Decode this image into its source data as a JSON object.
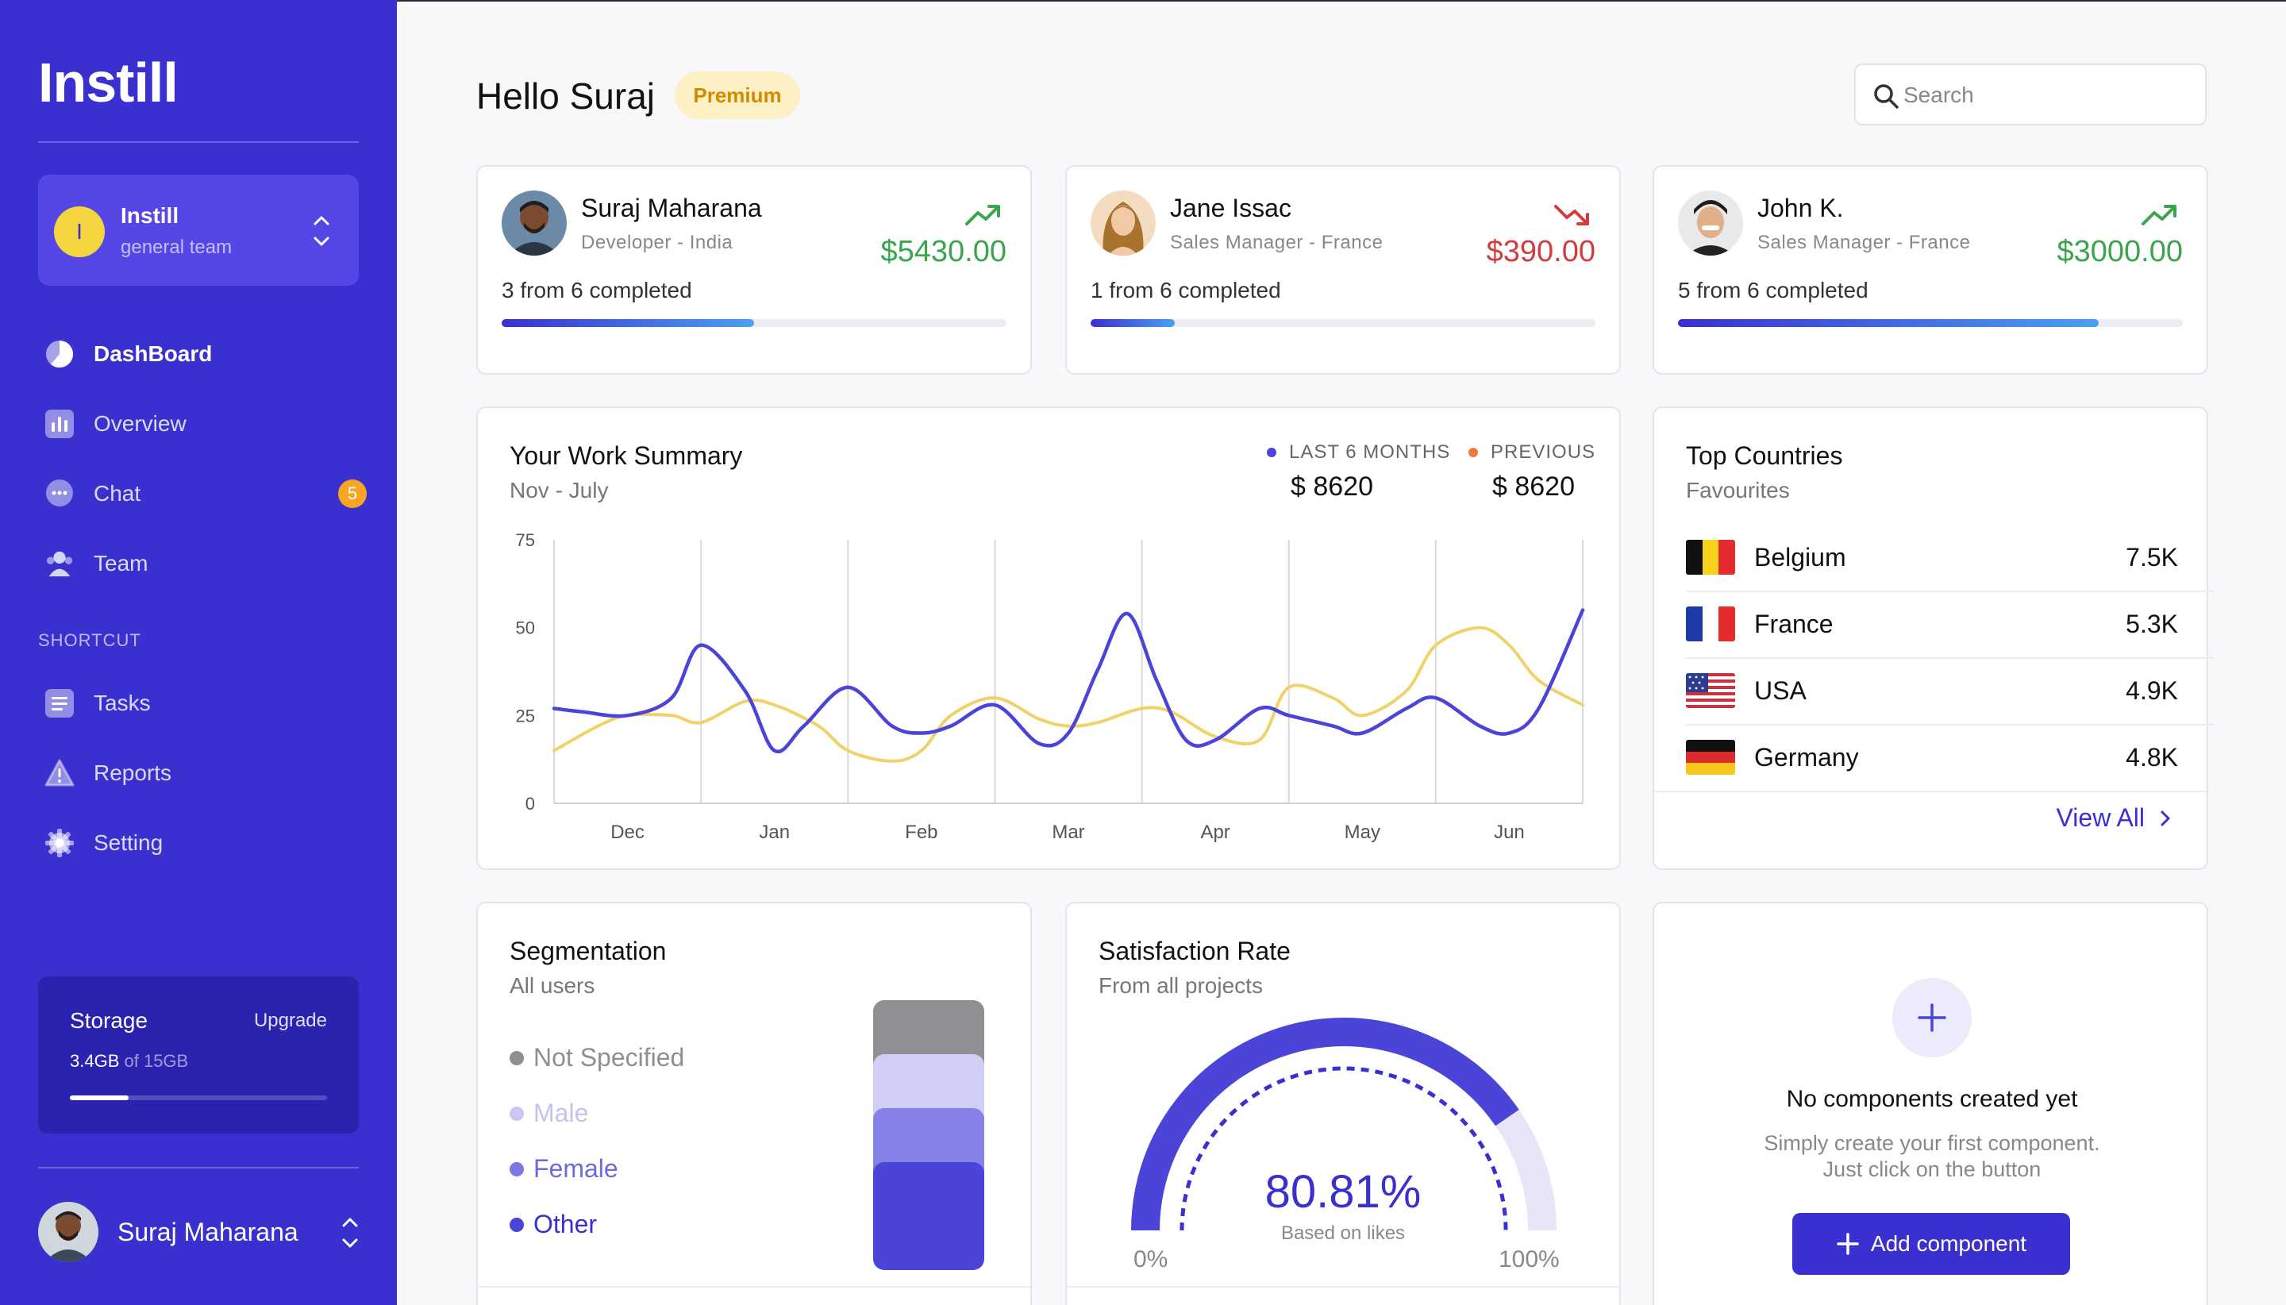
{
  "app": {
    "brand": "Instill"
  },
  "team": {
    "initial": "I",
    "name": "Instill",
    "subtitle": "general team"
  },
  "nav": [
    {
      "label": "DashBoard",
      "icon": "pie-chart-icon",
      "active": true
    },
    {
      "label": "Overview",
      "icon": "bar-chart-icon"
    },
    {
      "label": "Chat",
      "icon": "chat-icon",
      "badge": "5"
    },
    {
      "label": "Team",
      "icon": "team-icon"
    }
  ],
  "shortcut": {
    "label": "SHORTCUT",
    "items": [
      {
        "label": "Tasks",
        "icon": "tasks-icon"
      },
      {
        "label": "Reports",
        "icon": "reports-icon"
      },
      {
        "label": "Setting",
        "icon": "gear-icon"
      }
    ]
  },
  "storage": {
    "title": "Storage",
    "upgrade": "Upgrade",
    "used": "3.4GB",
    "of_text": "of 15GB",
    "fraction": 0.227
  },
  "user": {
    "name": "Suraj Maharana"
  },
  "header": {
    "greeting": "Hello Suraj",
    "badge": "Premium",
    "search_placeholder": "Search"
  },
  "people": [
    {
      "name": "Suraj Maharana",
      "role": "Developer - India",
      "amount": "$5430.00",
      "trend": "up",
      "progress": "3 from 6 completed",
      "fraction": 0.5
    },
    {
      "name": "Jane Issac",
      "role": "Sales Manager - France",
      "amount": "$390.00",
      "trend": "down",
      "progress": "1 from 6 completed",
      "fraction": 0.167
    },
    {
      "name": "John K.",
      "role": "Sales Manager - France",
      "amount": "$3000.00",
      "trend": "up",
      "progress": "5 from 6 completed",
      "fraction": 0.833
    }
  ],
  "work_summary": {
    "title": "Your Work Summary",
    "subtitle": "Nov - July",
    "legend": [
      {
        "label": "LAST 6 MONTHS",
        "value": "$ 8620",
        "color": "#4a44d8"
      },
      {
        "label": "PREVIOUS",
        "value": "$ 8620",
        "color": "#f07a3a"
      }
    ]
  },
  "chart_data": {
    "type": "line",
    "x_ticks": [
      "Dec",
      "Jan",
      "Feb",
      "Mar",
      "Apr",
      "May",
      "Jun"
    ],
    "y_ticks": [
      0,
      25,
      50,
      75
    ],
    "ylim": [
      0,
      75
    ],
    "xlim": [
      -0.5,
      6.5
    ],
    "grid": "vertical",
    "series": [
      {
        "color": "#4a44d8",
        "x": [
          -0.5,
          -0.3,
          0,
          0.3,
          0.5,
          0.8,
          1.0,
          1.2,
          1.5,
          1.8,
          2.0,
          2.2,
          2.5,
          2.8,
          3.0,
          3.2,
          3.4,
          3.6,
          3.8,
          4.0,
          4.3,
          4.5,
          4.8,
          5.0,
          5.3,
          5.5,
          5.8,
          6.0,
          6.2,
          6.5
        ],
        "y": [
          27,
          26,
          25,
          30,
          45,
          32,
          15,
          22,
          33,
          22,
          20,
          22,
          28,
          17,
          20,
          38,
          54,
          35,
          18,
          18,
          27,
          25,
          22,
          20,
          27,
          30,
          22,
          20,
          27,
          55
        ]
      },
      {
        "color": "#f0d26a",
        "x": [
          -0.5,
          -0.2,
          0,
          0.3,
          0.5,
          0.8,
          1.0,
          1.3,
          1.5,
          1.8,
          2.0,
          2.2,
          2.5,
          2.8,
          3.0,
          3.2,
          3.5,
          3.7,
          4.0,
          4.3,
          4.5,
          4.8,
          5.0,
          5.3,
          5.5,
          5.8,
          6.0,
          6.2,
          6.5
        ],
        "y": [
          15,
          22,
          25,
          25,
          23,
          29,
          28,
          22,
          15,
          12,
          15,
          25,
          30,
          24,
          22,
          23,
          27,
          26,
          19,
          18,
          33,
          30,
          25,
          32,
          45,
          50,
          45,
          35,
          28
        ]
      }
    ]
  },
  "countries": {
    "title": "Top Countries",
    "subtitle": "Favourites",
    "items": [
      {
        "name": "Belgium",
        "value": "7.5K"
      },
      {
        "name": "France",
        "value": "5.3K"
      },
      {
        "name": "USA",
        "value": "4.9K"
      },
      {
        "name": "Germany",
        "value": "4.8K"
      }
    ],
    "view_all": "View All"
  },
  "segmentation": {
    "title": "Segmentation",
    "subtitle": "All users",
    "items": [
      {
        "label": "Not Specified",
        "color": "#8f8f93"
      },
      {
        "label": "Male",
        "color": "#c9c8f3"
      },
      {
        "label": "Female",
        "color": "#7c77e2"
      },
      {
        "label": "Other",
        "color": "#4a44d8"
      }
    ]
  },
  "satisfaction": {
    "title": "Satisfaction Rate",
    "subtitle": "From all projects",
    "value": "80.81%",
    "value_fraction": 0.8081,
    "caption": "Based on likes",
    "min_label": "0%",
    "max_label": "100%"
  },
  "empty_state": {
    "title": "No components created yet",
    "line1": "Simply create your first component.",
    "line2": "Just click on the button",
    "button": "Add component"
  },
  "colors": {
    "sidebar": "#3a30cf",
    "accent": "#4a44d8",
    "success": "#3aa54b",
    "danger": "#d23c3c",
    "badge": "#f6a623"
  }
}
